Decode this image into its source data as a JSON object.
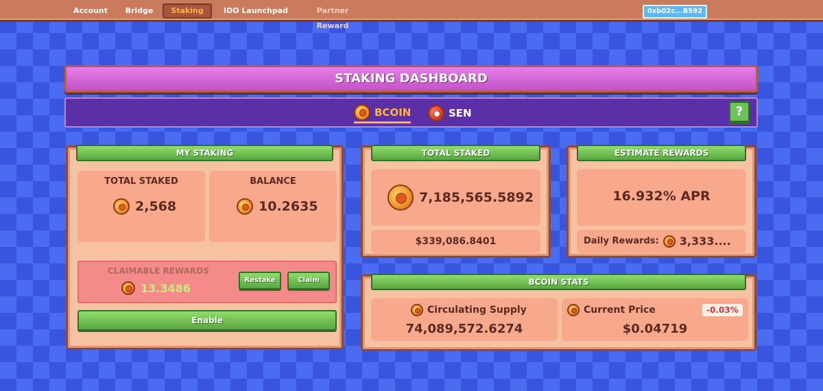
{
  "nav": {
    "items": [
      {
        "label": "Account"
      },
      {
        "label": "Bridge"
      },
      {
        "label": "Staking"
      },
      {
        "label": "IDO Launchpad"
      },
      {
        "label": "Partner Reward"
      }
    ],
    "wallet": "0xb02c...B592"
  },
  "header": {
    "title": "STAKING DASHBOARD"
  },
  "tabs": [
    {
      "label": "BCOIN"
    },
    {
      "label": "SEN"
    }
  ],
  "help": "?",
  "my_staking": {
    "title": "MY STAKING",
    "total_staked_label": "TOTAL STAKED",
    "total_staked_value": "2,568",
    "balance_label": "BALANCE",
    "balance_value": "10.2635",
    "claimable_label": "CLAIMABLE REWARDS",
    "claimable_value": "13.3486",
    "restake": "Restake",
    "claim": "Claim",
    "enable": "Enable"
  },
  "total_staked": {
    "title": "TOTAL STAKED",
    "value": "7,185,565.5892",
    "usd": "$339,086.8401"
  },
  "estimate_rewards": {
    "title": "ESTIMATE REWARDS",
    "apr": "16.932% APR",
    "daily_label": "Daily Rewards:",
    "daily_value": "3,333...."
  },
  "bcoin_stats": {
    "title": "BCOIN STATS",
    "supply_label": "Circulating Supply",
    "supply_value": "74,089,572.6274",
    "price_label": "Current Price",
    "price_value": "$0.04719",
    "price_change": "-0.03%"
  },
  "colors": {
    "accent": "#ffb43a",
    "green": "#6cc35a",
    "panel": "#f6c2a2",
    "negative": "#d9343a"
  }
}
